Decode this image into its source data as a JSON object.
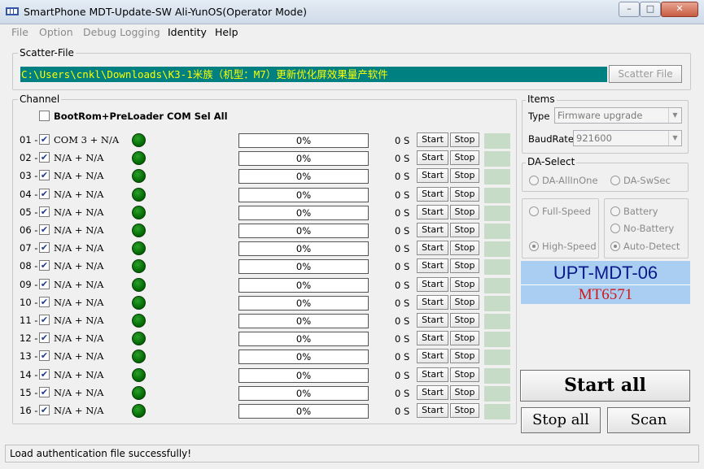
{
  "window": {
    "title": "SmartPhone MDT-Update-SW Ali-YunOS(Operator Mode)",
    "min_glyph": "–",
    "max_glyph": "□",
    "close_glyph": "✕"
  },
  "menu": {
    "items": [
      {
        "label": "File",
        "enabled": false
      },
      {
        "label": "Option",
        "enabled": false
      },
      {
        "label": "Debug Logging",
        "enabled": false
      },
      {
        "label": "Identity",
        "enabled": true
      },
      {
        "label": "Help",
        "enabled": true
      }
    ]
  },
  "scatter": {
    "group_title": "Scatter-File",
    "path": "C:\\Users\\cnkl\\Downloads\\K3-1米族（机型：M7）更新优化屏效果量产软件",
    "button_label": "Scatter File"
  },
  "channel": {
    "group_title": "Channel",
    "select_all_label": "BootRom+PreLoader COM Sel All",
    "select_all_checked": false,
    "start_label": "Start",
    "stop_label": "Stop",
    "rows": [
      {
        "num": "01 -",
        "port": "COM 3 + N/A",
        "checked": true,
        "progress": "0%",
        "time": "0 S"
      },
      {
        "num": "02 -",
        "port": "N/A + N/A",
        "checked": true,
        "progress": "0%",
        "time": "0 S"
      },
      {
        "num": "03 -",
        "port": "N/A + N/A",
        "checked": true,
        "progress": "0%",
        "time": "0 S"
      },
      {
        "num": "04 -",
        "port": "N/A + N/A",
        "checked": true,
        "progress": "0%",
        "time": "0 S"
      },
      {
        "num": "05 -",
        "port": "N/A + N/A",
        "checked": true,
        "progress": "0%",
        "time": "0 S"
      },
      {
        "num": "06 -",
        "port": "N/A + N/A",
        "checked": true,
        "progress": "0%",
        "time": "0 S"
      },
      {
        "num": "07 -",
        "port": "N/A + N/A",
        "checked": true,
        "progress": "0%",
        "time": "0 S"
      },
      {
        "num": "08 -",
        "port": "N/A + N/A",
        "checked": true,
        "progress": "0%",
        "time": "0 S"
      },
      {
        "num": "09 -",
        "port": "N/A + N/A",
        "checked": true,
        "progress": "0%",
        "time": "0 S"
      },
      {
        "num": "10 -",
        "port": "N/A + N/A",
        "checked": true,
        "progress": "0%",
        "time": "0 S"
      },
      {
        "num": "11 -",
        "port": "N/A + N/A",
        "checked": true,
        "progress": "0%",
        "time": "0 S"
      },
      {
        "num": "12 -",
        "port": "N/A + N/A",
        "checked": true,
        "progress": "0%",
        "time": "0 S"
      },
      {
        "num": "13 -",
        "port": "N/A + N/A",
        "checked": true,
        "progress": "0%",
        "time": "0 S"
      },
      {
        "num": "14 -",
        "port": "N/A + N/A",
        "checked": true,
        "progress": "0%",
        "time": "0 S"
      },
      {
        "num": "15 -",
        "port": "N/A + N/A",
        "checked": true,
        "progress": "0%",
        "time": "0 S"
      },
      {
        "num": "16 -",
        "port": "N/A + N/A",
        "checked": true,
        "progress": "0%",
        "time": "0 S"
      }
    ]
  },
  "items": {
    "group_title": "Items",
    "type_label": "Type",
    "type_value": "Firmware upgrade",
    "baudrate_label": "BaudRate",
    "baudrate_value": "921600"
  },
  "da_select": {
    "group_title": "DA-Select",
    "option_allinone": "DA-AllInOne",
    "option_swsec": "DA-SwSec"
  },
  "speed": {
    "full": "Full-Speed",
    "high": "High-Speed",
    "selected": "High-Speed"
  },
  "battery": {
    "battery": "Battery",
    "no_battery": "No-Battery",
    "auto_detect": "Auto-Detect",
    "selected": "Auto-Detect"
  },
  "banner": {
    "model": "UPT-MDT-06",
    "chip": "MT6571"
  },
  "actions": {
    "start_all": "Start all",
    "stop_all": "Stop all",
    "scan": "Scan"
  },
  "status": {
    "text": "Load authentication file successfully!"
  },
  "colors": {
    "scatter_bg": "#008080",
    "scatter_text": "#ffff00",
    "led_green": "#008000",
    "banner_bg": "#a9cef2",
    "banner_model_text": "#0a1a8a",
    "banner_chip_text": "#d01818"
  }
}
